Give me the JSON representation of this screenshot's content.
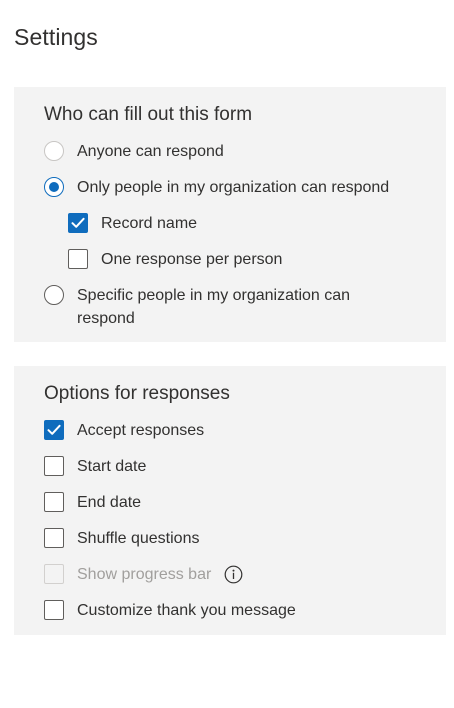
{
  "page": {
    "title": "Settings"
  },
  "who_section": {
    "heading": "Who can fill out this form",
    "options": {
      "anyone": {
        "label": "Anyone can respond",
        "selected": false,
        "disabled": true
      },
      "org_only": {
        "label": "Only people in my organization can respond",
        "selected": true
      },
      "record_name": {
        "label": "Record name",
        "checked": true
      },
      "one_response": {
        "label": "One response per person",
        "checked": false
      },
      "specific": {
        "label": "Specific people in my organization can respond",
        "selected": false
      }
    }
  },
  "response_section": {
    "heading": "Options for responses",
    "options": {
      "accept": {
        "label": "Accept responses",
        "checked": true
      },
      "start_date": {
        "label": "Start date",
        "checked": false
      },
      "end_date": {
        "label": "End date",
        "checked": false
      },
      "shuffle": {
        "label": "Shuffle questions",
        "checked": false
      },
      "progress": {
        "label": "Show progress bar",
        "checked": false,
        "disabled": true,
        "icon": "info-icon"
      },
      "thank_you": {
        "label": "Customize thank you message",
        "checked": false
      }
    }
  },
  "colors": {
    "accent": "#0f6cbd",
    "section_bg": "#f3f3f3",
    "text": "#323130",
    "disabled_text": "#a19f9d"
  }
}
